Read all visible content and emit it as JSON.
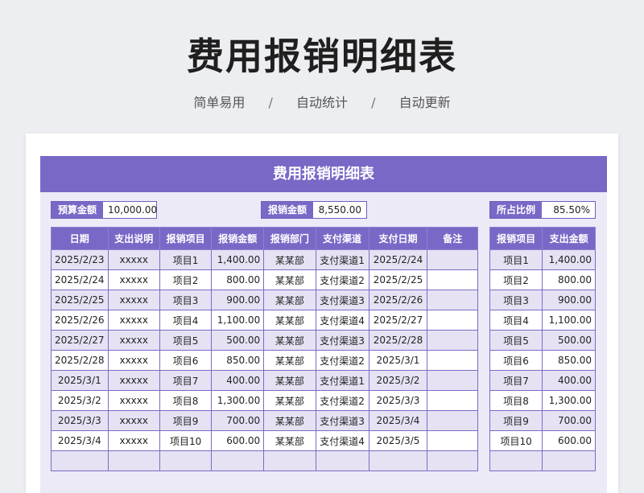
{
  "hero": {
    "title": "费用报销明细表",
    "features": [
      "简单易用",
      "自动统计",
      "自动更新"
    ],
    "separator": "/"
  },
  "sheet": {
    "title": "费用报销明细表",
    "budget": {
      "label": "预算金额",
      "value": "10,000.00"
    },
    "reimbursed": {
      "label": "报销金额",
      "value": "8,550.00"
    },
    "ratio": {
      "label": "所占比例",
      "value": "85.50%"
    }
  },
  "main_table": {
    "headers": [
      "日期",
      "支出说明",
      "报销项目",
      "报销金额",
      "报销部门",
      "支付渠道",
      "支付日期",
      "备注"
    ],
    "rows": [
      [
        "2025/2/23",
        "xxxxx",
        "项目1",
        "1,400.00",
        "某某部",
        "支付渠道1",
        "2025/2/24",
        ""
      ],
      [
        "2025/2/24",
        "xxxxx",
        "项目2",
        "800.00",
        "某某部",
        "支付渠道2",
        "2025/2/25",
        ""
      ],
      [
        "2025/2/25",
        "xxxxx",
        "项目3",
        "900.00",
        "某某部",
        "支付渠道3",
        "2025/2/26",
        ""
      ],
      [
        "2025/2/26",
        "xxxxx",
        "项目4",
        "1,100.00",
        "某某部",
        "支付渠道4",
        "2025/2/27",
        ""
      ],
      [
        "2025/2/27",
        "xxxxx",
        "项目5",
        "500.00",
        "某某部",
        "支付渠道3",
        "2025/2/28",
        ""
      ],
      [
        "2025/2/28",
        "xxxxx",
        "项目6",
        "850.00",
        "某某部",
        "支付渠道2",
        "2025/3/1",
        ""
      ],
      [
        "2025/3/1",
        "xxxxx",
        "项目7",
        "400.00",
        "某某部",
        "支付渠道1",
        "2025/3/2",
        ""
      ],
      [
        "2025/3/2",
        "xxxxx",
        "项目8",
        "1,300.00",
        "某某部",
        "支付渠道2",
        "2025/3/3",
        ""
      ],
      [
        "2025/3/3",
        "xxxxx",
        "项目9",
        "700.00",
        "某某部",
        "支付渠道3",
        "2025/3/4",
        ""
      ],
      [
        "2025/3/4",
        "xxxxx",
        "项目10",
        "600.00",
        "某某部",
        "支付渠道4",
        "2025/3/5",
        ""
      ],
      [
        "",
        "",
        "",
        "",
        "",
        "",
        "",
        ""
      ]
    ]
  },
  "side_table": {
    "headers": [
      "报销项目",
      "支出金额"
    ],
    "rows": [
      [
        "项目1",
        "1,400.00"
      ],
      [
        "项目2",
        "800.00"
      ],
      [
        "项目3",
        "900.00"
      ],
      [
        "项目4",
        "1,100.00"
      ],
      [
        "项目5",
        "500.00"
      ],
      [
        "项目6",
        "850.00"
      ],
      [
        "项目7",
        "400.00"
      ],
      [
        "项目8",
        "1,300.00"
      ],
      [
        "项目9",
        "700.00"
      ],
      [
        "项目10",
        "600.00"
      ],
      [
        "",
        ""
      ]
    ]
  }
}
